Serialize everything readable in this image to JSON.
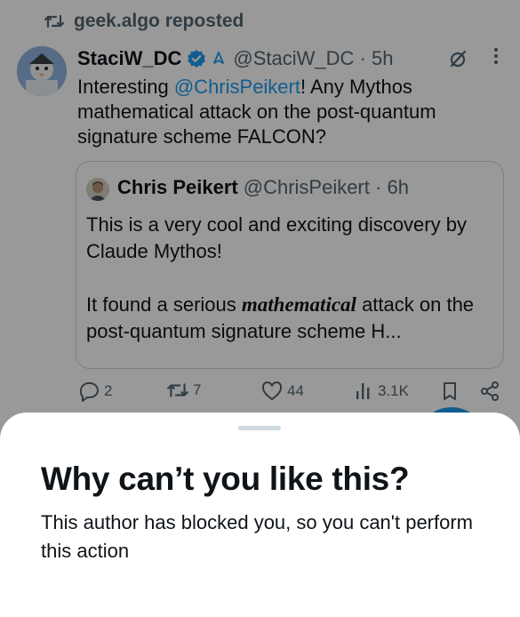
{
  "tweet": {
    "repost_label": "geek.algo reposted",
    "author": {
      "display_name": "StaciW_DC",
      "handle": "@StaciW_DC",
      "separator": "·",
      "time": "5h"
    },
    "text_parts": {
      "before": "Interesting ",
      "mention": "@ChrisPeikert",
      "after": "! Any Mythos mathematical attack on the post-quantum signature scheme FALCON?"
    },
    "quote": {
      "display_name": "Chris Peikert",
      "handle": "@ChrisPeikert",
      "separator": "·",
      "time": "6h",
      "para1": "This is a very cool and exciting discovery by Claude Mythos!",
      "para2_before": "It found a serious ",
      "para2_emphasis": "mathematical",
      "para2_after": " attack on the post-quantum signature scheme H..."
    },
    "actions": {
      "replies": "2",
      "reposts": "7",
      "likes": "44",
      "views": "3.1K"
    }
  },
  "sheet": {
    "title": "Why can’t you like this?",
    "body": "This author has blocked you, so you can't perform this action"
  },
  "colors": {
    "accent": "#1d9bf0",
    "text_primary": "#0f1419",
    "text_secondary": "#536471",
    "border": "#cfd9de"
  },
  "icons": {
    "repost": "repost-icon",
    "verified": "verified-badge-icon",
    "grok": "grok-icon",
    "more": "more-dots-icon",
    "reply": "reply-icon",
    "like": "heart-icon",
    "views": "views-icon",
    "bookmark": "bookmark-icon",
    "share": "share-icon"
  }
}
